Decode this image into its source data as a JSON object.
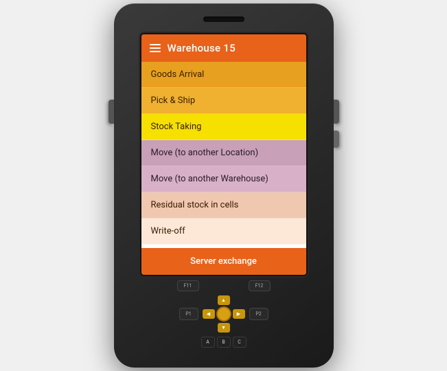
{
  "header": {
    "title": "Warehouse 15",
    "menu_icon": "hamburger"
  },
  "menu": {
    "items": [
      {
        "id": "goods-arrival",
        "label": "Goods Arrival",
        "color": "#e8a020",
        "text_color": "#3a2000"
      },
      {
        "id": "pick-ship",
        "label": "Pick & Ship",
        "color": "#f0b030",
        "text_color": "#3a2000"
      },
      {
        "id": "stock-taking",
        "label": "Stock Taking",
        "color": "#f5e000",
        "text_color": "#3a2000"
      },
      {
        "id": "move-location",
        "label": "Move (to another Location)",
        "color": "#c8a0b8",
        "text_color": "#2a1a2a"
      },
      {
        "id": "move-warehouse",
        "label": "Move (to another Warehouse)",
        "color": "#d8b0c8",
        "text_color": "#2a1a2a"
      },
      {
        "id": "residual",
        "label": "Residual stock in cells",
        "color": "#f0c8b0",
        "text_color": "#3a1a00"
      },
      {
        "id": "writeoff",
        "label": "Write-off",
        "color": "#fde8d8",
        "text_color": "#3a1a00"
      }
    ],
    "server_exchange_label": "Server exchange"
  },
  "keypad": {
    "fn_keys": [
      "F11",
      "F12"
    ],
    "action_keys": [
      "P1",
      "P2"
    ],
    "letters": [
      "A",
      "B",
      "C"
    ]
  }
}
